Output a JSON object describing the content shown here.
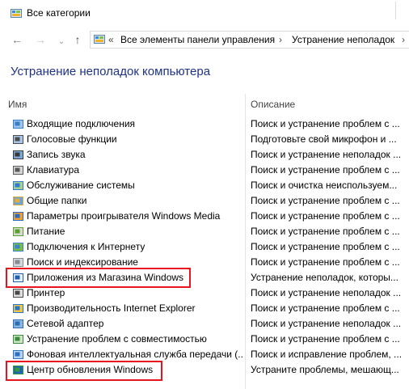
{
  "window": {
    "title": "Все категории"
  },
  "address": {
    "crumbs": [
      "Все элементы панели управления",
      "Устранение неполадок"
    ],
    "overflow": "«",
    "separator": "›"
  },
  "page": {
    "title": "Устранение неполадок компьютера"
  },
  "columns": {
    "name": "Имя",
    "description": "Описание"
  },
  "colors": {
    "title_blue": "#1e3287",
    "highlight": "#e8141e"
  },
  "items": [
    {
      "name": "Входящие подключения",
      "description": "Поиск и устранение проблем с ...",
      "icon": "network-connections-icon"
    },
    {
      "name": "Голосовые функции",
      "description": "Подготовьте свой микрофон и ...",
      "icon": "microphone-icon"
    },
    {
      "name": "Запись звука",
      "description": "Поиск и устранение неполадок ...",
      "icon": "sound-recording-icon"
    },
    {
      "name": "Клавиатура",
      "description": "Поиск и устранение проблем с ...",
      "icon": "keyboard-icon"
    },
    {
      "name": "Обслуживание системы",
      "description": "Поиск и очистка неиспользуем...",
      "icon": "system-maintenance-icon"
    },
    {
      "name": "Общие папки",
      "description": "Поиск и устранение проблем с ...",
      "icon": "shared-folders-icon"
    },
    {
      "name": "Параметры проигрывателя Windows Media",
      "description": "Поиск и устранение проблем с ...",
      "icon": "media-player-icon"
    },
    {
      "name": "Питание",
      "description": "Поиск и устранение проблем с ...",
      "icon": "power-icon"
    },
    {
      "name": "Подключения к Интернету",
      "description": "Поиск и устранение проблем с ...",
      "icon": "internet-connections-icon"
    },
    {
      "name": "Поиск и индексирование",
      "description": "Поиск и устранение проблем с ...",
      "icon": "search-indexing-icon"
    },
    {
      "name": "Приложения из Магазина Windows",
      "description": "Устранение неполадок, которы...",
      "icon": "store-apps-icon"
    },
    {
      "name": "Принтер",
      "description": "Поиск и устранение неполадок ...",
      "icon": "printer-icon"
    },
    {
      "name": "Производительность Internet Explorer",
      "description": "Поиск и устранение проблем с ...",
      "icon": "ie-performance-icon"
    },
    {
      "name": "Сетевой адаптер",
      "description": "Поиск и устранение неполадок ...",
      "icon": "network-adapter-icon"
    },
    {
      "name": "Устранение проблем с совместимостью",
      "description": "Поиск и устранение проблем с ...",
      "icon": "compatibility-icon"
    },
    {
      "name": "Фоновая интеллектуальная служба передачи (...",
      "description": "Поиск и исправление проблем, ...",
      "icon": "bits-icon"
    },
    {
      "name": "Центр обновления Windows",
      "description": "Устраните проблемы, мешающ...",
      "icon": "windows-update-icon"
    }
  ]
}
